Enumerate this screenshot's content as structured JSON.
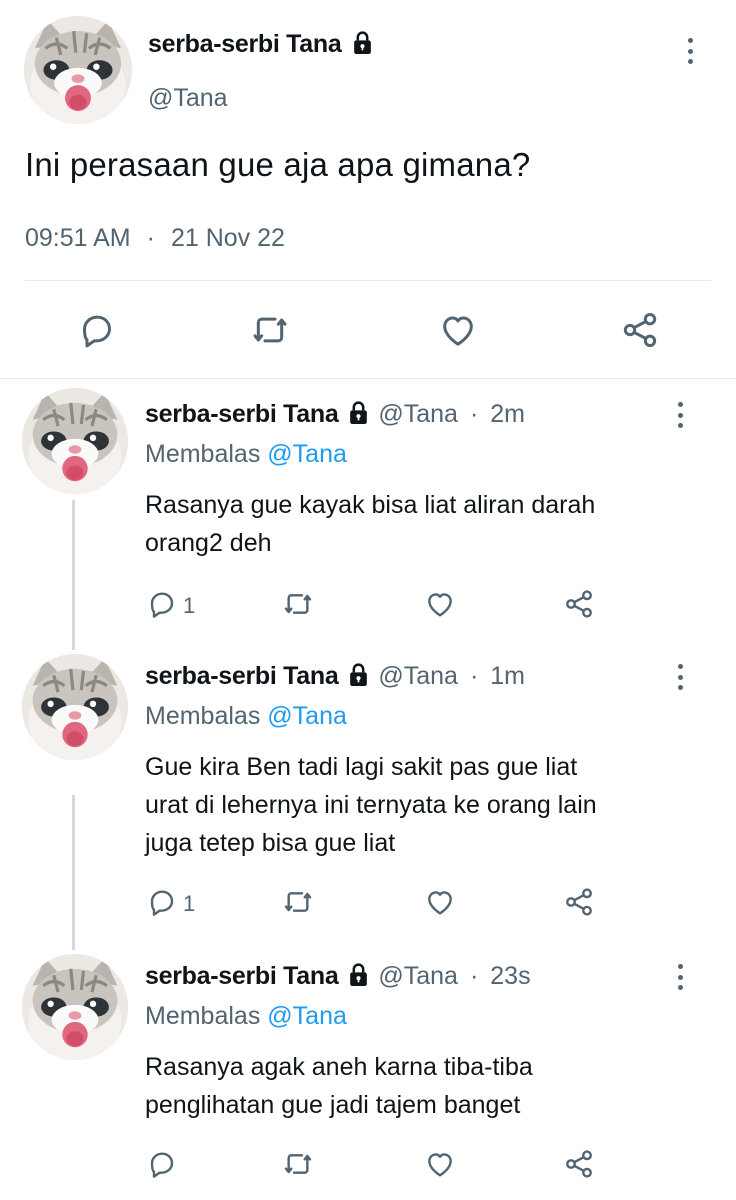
{
  "main_tweet": {
    "author_name": "serba-serbi Tana",
    "handle": "@Tana",
    "text": "Ini perasaan gue aja apa gimana?",
    "time": "09:51 AM",
    "separator": "·",
    "date": "21 Nov 22",
    "locked": true
  },
  "replies": [
    {
      "author_name": "serba-serbi Tana",
      "handle": "@Tana",
      "separator": "·",
      "time": "2m",
      "replying_label": "Membalas",
      "replying_to": "@Tana",
      "text_lines": [
        "Rasanya gue kayak bisa liat aliran darah",
        "orang2 deh"
      ],
      "reply_count": "1"
    },
    {
      "author_name": "serba-serbi Tana",
      "handle": "@Tana",
      "separator": "·",
      "time": "1m",
      "replying_label": "Membalas",
      "replying_to": "@Tana",
      "text_lines": [
        "Gue kira Ben tadi lagi sakit pas gue liat",
        "urat di lehernya ini ternyata ke orang lain",
        "juga tetep bisa gue liat"
      ],
      "reply_count": "1"
    },
    {
      "author_name": "serba-serbi Tana",
      "handle": "@Tana",
      "separator": "·",
      "time": "23s",
      "replying_label": "Membalas",
      "replying_to": "@Tana",
      "text_lines": [
        "Rasanya agak aneh karna tiba-tiba",
        "penglihatan gue jadi tajem banget"
      ],
      "reply_count": ""
    }
  ],
  "icons": {
    "reply": "reply-icon",
    "retweet": "retweet-icon",
    "like": "heart-icon",
    "share": "share-icon",
    "more": "more-options-icon",
    "lock": "lock-icon"
  },
  "colors": {
    "text": "#0f1419",
    "secondary": "#536471",
    "mention": "#1d9bf0",
    "divider": "#e6ecf0"
  }
}
